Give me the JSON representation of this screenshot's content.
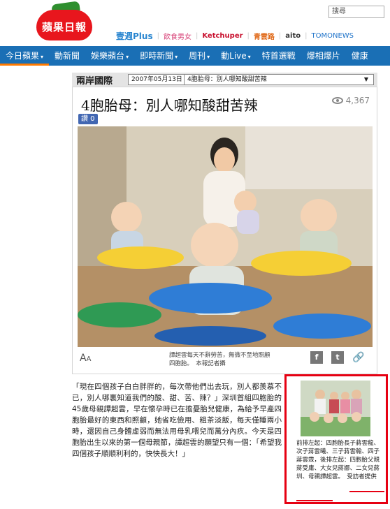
{
  "header": {
    "logo_text": "蘋果日報",
    "search_placeholder": "搜尋",
    "partners": [
      "壹週Plus",
      "飲食男女",
      "Ketchuper",
      "青雲路",
      "aito",
      "TOMONEWS"
    ]
  },
  "nav": {
    "items": [
      {
        "label": "今日蘋果",
        "dropdown": true
      },
      {
        "label": "動新聞",
        "dropdown": false
      },
      {
        "label": "娛樂蘋台",
        "dropdown": true
      },
      {
        "label": "即時新聞",
        "dropdown": true
      },
      {
        "label": "周刊",
        "dropdown": true
      },
      {
        "label": "動Live",
        "dropdown": true
      },
      {
        "label": "特首選戰",
        "dropdown": false
      },
      {
        "label": "爆相爆片",
        "dropdown": false
      },
      {
        "label": "健康",
        "dropdown": false
      }
    ]
  },
  "article": {
    "section": "兩岸國際",
    "date": "2007年05月13日",
    "select_title": "4胞胎母：別人哪知酸甜苦辣",
    "headline": "4胞胎母：別人哪知酸甜苦辣",
    "views": "4,367",
    "like_label": "讚 0",
    "font_size_label": "A",
    "caption": "譚超雲每天不辭勞苦，無微不至地照顧四胞胎。　本報記者攝",
    "body": "「現在四個孩子白白胖胖的，每次帶他們出去玩，別人都羨慕不已，別人哪裏知道我們的酸、甜、苦、辣？」深圳首組四胞胎的45歲母親譚超雲，早在懷孕時已在擔憂胎兒健康，為給予早產四胞胎最好的東西和照顧，她省吃儉用、粗茶淡飯，每天僅睡兩小時，還因自己身體虛弱而無法用母乳喂兒而萬分內疚。今天是四胞胎出生以來的第一個母親節，譚超雲的願望只有一個：「希望我四個孩子順順利利的，快快長大！」"
  },
  "sidebar": {
    "caption": "前排左起：四胞胎長子蔣雲龍、次子蔣雲曦、三子蔣雲翰、四子蔣雲霖，後排左起：四胞胎父親蔣受庸、大女兒蔣娜、二女兒蔣圳、母親譚超雲。　受訪者提供"
  }
}
